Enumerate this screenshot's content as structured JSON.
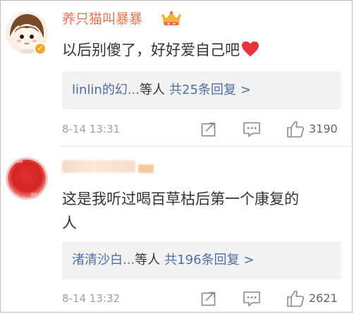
{
  "comments": [
    {
      "username": "养只猫叫暴暴",
      "avatar_icon": "cartoon-girl-avatar",
      "badge_icon": "verified-badge",
      "crown_icon": "vip-crown-icon",
      "text_lines": [
        "以后别傻了，好好爱自己吧"
      ],
      "trailing_emoji": "heart-icon",
      "reply_summary": {
        "names": "linlin的幻...",
        "suffix": "等人",
        "count_text": "共25条回复",
        "chevron": ">"
      },
      "timestamp": "8-14 13:31",
      "likes": "3190"
    },
    {
      "username": "",
      "avatar_icon": "blurred-red-avatar",
      "text_lines": [
        "这是我听过喝百草枯后第一个康复的",
        "人"
      ],
      "reply_summary": {
        "names": "渚清沙白...",
        "suffix": "等人",
        "count_text": "共196条回复",
        "chevron": ">"
      },
      "timestamp": "8-14 13:32",
      "likes": "2621"
    }
  ],
  "colors": {
    "username": "#eb7350",
    "link": "#4e6ea5",
    "meta": "#a0a0a0",
    "reply_bg": "#f2f2f2",
    "heart": "#e8323c"
  }
}
